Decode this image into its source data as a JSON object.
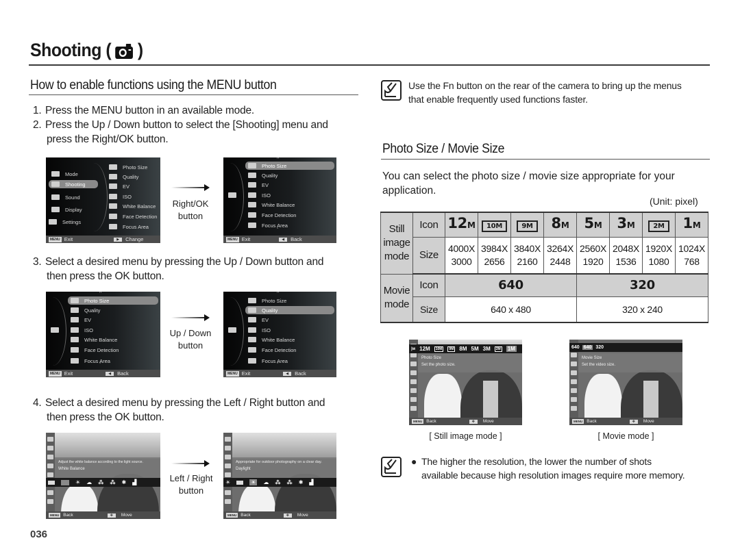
{
  "page": {
    "title": "Shooting (",
    "title_close": ")",
    "title_icon": "camera-icon",
    "page_number": "036"
  },
  "left": {
    "heading": "How to enable functions using the MENU button",
    "steps": [
      {
        "num": "1.",
        "text": "Press the MENU button in an available mode.",
        "cont": ""
      },
      {
        "num": "2.",
        "text": "Press the Up / Down button to select the [Shooting] menu and",
        "cont": "press the Right/OK button."
      },
      {
        "num": "3.",
        "text": "Select a desired menu by pressing the Up / Down button and",
        "cont": "then press the OK button."
      },
      {
        "num": "4.",
        "text": "Select a desired menu by pressing the Left / Right button and",
        "cont": "then press the OK button."
      }
    ],
    "arrows": [
      {
        "line1": "Right/OK",
        "line2": "button"
      },
      {
        "line1": "Up / Down",
        "line2": "button"
      },
      {
        "line1": "Left / Right",
        "line2": "button"
      }
    ],
    "main_menu": {
      "categories": [
        "Mode",
        "Shooting",
        "Sound",
        "Display",
        "Settings"
      ],
      "selected": "Shooting",
      "items": [
        "Photo Size",
        "Quality",
        "EV",
        "ISO",
        "White Balance",
        "Face Detection",
        "Focus Area"
      ],
      "footer_left_key": "MENU",
      "footer_left": "Exit",
      "footer_right": "Change"
    },
    "shooting_menu": {
      "items": [
        "Photo Size",
        "Quality",
        "EV",
        "ISO",
        "White Balance",
        "Face Detection",
        "Focus Area"
      ],
      "footer_left_key": "MENU",
      "footer_left": "Exit",
      "footer_right": "Back",
      "selected_a": "Photo Size",
      "selected_b": "Quality"
    },
    "wb_screens": [
      {
        "desc": "Adjust the white balance according to the light source.",
        "title": "White Balance",
        "footer_left": "Back",
        "footer_right": "Move",
        "footer_key": "MENU"
      },
      {
        "desc": "Appropriate for outdoor photography on a clear day.",
        "title": "Daylight",
        "footer_left": "Back",
        "footer_right": "Move",
        "footer_key": "MENU"
      }
    ],
    "wb_options": [
      "AWB",
      "Custom",
      "Daylight",
      "Cloudy",
      "Fluorescent H",
      "Fluorescent L",
      "Tungsten",
      "Custom Set"
    ]
  },
  "right": {
    "tip": {
      "icon": "note-icon",
      "line1": "Use the Fn button on the rear of the camera to bring up the menus",
      "line2": "that enable frequently used functions faster."
    },
    "heading": "Photo Size / Movie Size",
    "intro_line1": "You can select the photo size / movie size appropriate for your",
    "intro_line2": "application.",
    "unit": "(Unit: pixel)",
    "table": {
      "still_mode_label": [
        "Still",
        "image",
        "mode"
      ],
      "movie_mode_label": [
        "Movie",
        "mode"
      ],
      "icon_label": "Icon",
      "size_label": "Size",
      "still": [
        {
          "icon": "12",
          "unit": "M",
          "boxed": false,
          "w": "4000X",
          "h": "3000"
        },
        {
          "icon": "10M",
          "unit": "",
          "boxed": true,
          "w": "3984X",
          "h": "2656"
        },
        {
          "icon": "9M",
          "unit": "",
          "boxed": true,
          "w": "3840X",
          "h": "2160"
        },
        {
          "icon": "8",
          "unit": "M",
          "boxed": false,
          "w": "3264X",
          "h": "2448"
        },
        {
          "icon": "5",
          "unit": "M",
          "boxed": false,
          "w": "2560X",
          "h": "1920"
        },
        {
          "icon": "3",
          "unit": "M",
          "boxed": false,
          "w": "2048X",
          "h": "1536"
        },
        {
          "icon": "2M",
          "unit": "",
          "boxed": true,
          "w": "1920X",
          "h": "1080"
        },
        {
          "icon": "1",
          "unit": "M",
          "boxed": false,
          "w": "1024X",
          "h": "768"
        }
      ],
      "movie": [
        {
          "icon": "640",
          "size": "640 x 480"
        },
        {
          "icon": "320",
          "size": "320 x 240"
        }
      ]
    },
    "still_screen": {
      "strip": [
        "12M",
        "10M",
        "9M",
        "8M",
        "5M",
        "3M",
        "2M",
        "1M"
      ],
      "title": "Photo Size",
      "desc": "Set the photo size.",
      "footer_key": "MENU",
      "footer_left": "Back",
      "footer_right": "Move",
      "caption": "[ Still image mode ]"
    },
    "movie_screen": {
      "strip": [
        "640",
        "640",
        "320"
      ],
      "title": "Movie Size",
      "desc": "Set the video size.",
      "footer_key": "MENU",
      "footer_left": "Back",
      "footer_right": "Move",
      "caption": "[ Movie mode ]"
    },
    "note": {
      "icon": "note-icon",
      "bullet": "●",
      "line1": "The higher the resolution, the lower the number of shots",
      "line2": "available because high resolution images require more memory."
    }
  }
}
